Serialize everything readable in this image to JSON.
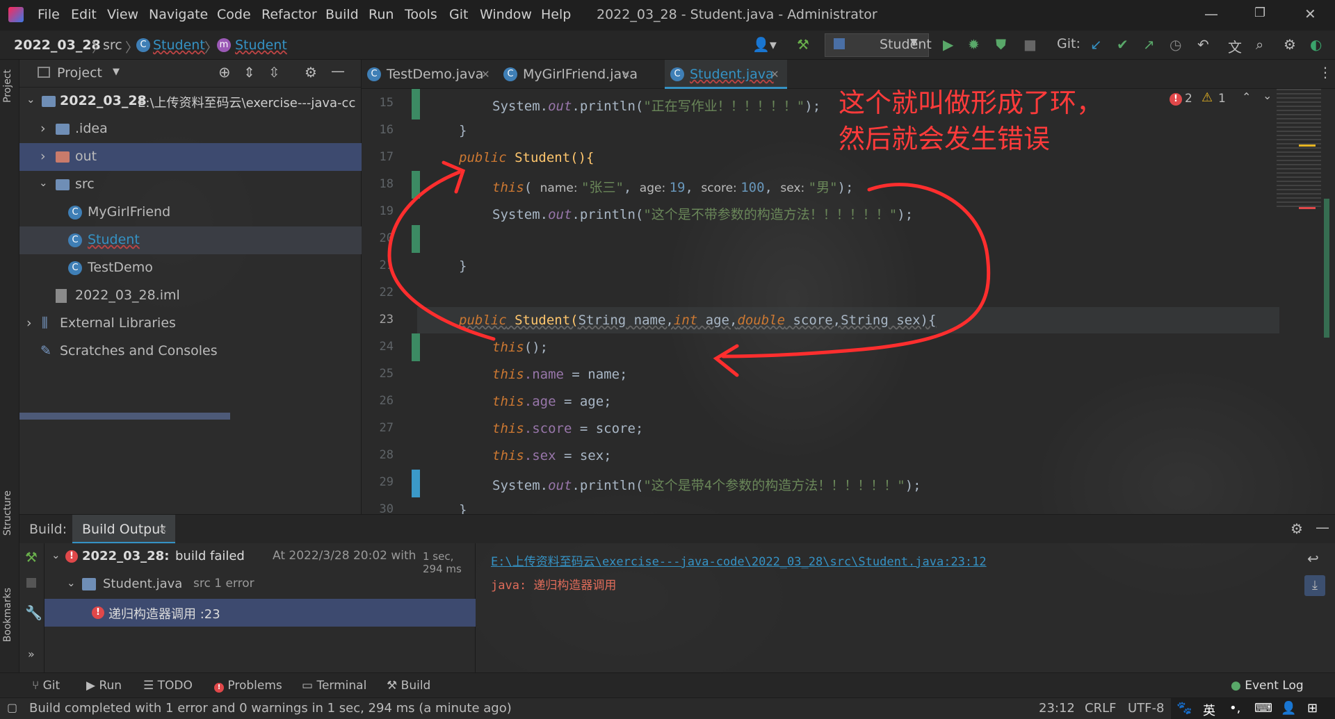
{
  "window": {
    "title": "2022_03_28 - Student.java - Administrator",
    "menu": [
      "File",
      "Edit",
      "View",
      "Navigate",
      "Code",
      "Refactor",
      "Build",
      "Run",
      "Tools",
      "Git",
      "Window",
      "Help"
    ]
  },
  "navbar": {
    "breadcrumbs": [
      "2022_03_28",
      "src",
      "Student",
      "Student"
    ],
    "run_config": "Student",
    "git_label": "Git:"
  },
  "project": {
    "panel_title": "Project",
    "tree": [
      {
        "label": "2022_03_28",
        "detail": "E:\\上传资料至码云\\exercise---java-cc",
        "type": "module"
      },
      {
        "label": ".idea",
        "type": "folder"
      },
      {
        "label": "out",
        "type": "folder-excluded"
      },
      {
        "label": "src",
        "type": "folder"
      },
      {
        "label": "MyGirlFriend",
        "type": "class"
      },
      {
        "label": "Student",
        "type": "class"
      },
      {
        "label": "TestDemo",
        "type": "class"
      },
      {
        "label": "2022_03_28.iml",
        "type": "file"
      },
      {
        "label": "External Libraries",
        "type": "libs"
      },
      {
        "label": "Scratches and Consoles",
        "type": "scratches"
      }
    ]
  },
  "tabs": [
    {
      "label": "TestDemo.java"
    },
    {
      "label": "MyGirlFriend.java"
    },
    {
      "label": "Student.java",
      "active": true
    }
  ],
  "editor": {
    "line_numbers": [
      "15",
      "16",
      "17",
      "18",
      "19",
      "20",
      "21",
      "22",
      "23",
      "24",
      "25",
      "26",
      "27",
      "28",
      "29",
      "30"
    ],
    "inspection": {
      "errors": "2",
      "warnings": "1"
    },
    "annotation_line1": "这个就叫做形成了环，",
    "annotation_line2": "然后就会发生错误",
    "code": {
      "l15_a": "System.",
      "l15_b": "out",
      "l15_c": ".println(",
      "l15_d": "\"正在写作业！！！！！！\"",
      "l15_e": ");",
      "l16": "}",
      "l17_kw": "public",
      "l17_rest": " Student(){",
      "l18_this": "this",
      "l18_open": "( ",
      "l18_h1": "name: ",
      "l18_s1": "\"张三\"",
      "l18_c1": ", ",
      "l18_h2": "age: ",
      "l18_n1": "19",
      "l18_c2": ", ",
      "l18_h3": "score: ",
      "l18_n2": "100",
      "l18_c3": ", ",
      "l18_h4": "sex: ",
      "l18_s2": "\"男\"",
      "l18_end": ");",
      "l19_a": "System.",
      "l19_b": "out",
      "l19_c": ".println(",
      "l19_d": "\"这个是不带参数的构造方法！！！！！！\"",
      "l19_e": ");",
      "l21": "}",
      "l23_kw1": "public",
      "l23_name": " Student(",
      "l23_t1": "String",
      "l23_p1": " name,",
      "l23_t2": "int",
      "l23_p2": " age,",
      "l23_t3": "double",
      "l23_p3": " score,",
      "l23_t4": "String",
      "l23_p4": " sex){",
      "l24_this": "this",
      "l24_rest": "();",
      "l25_this": "this",
      "l25_fld": ".name",
      "l25_rest": " = name;",
      "l26_this": "this",
      "l26_fld": ".age",
      "l26_rest": " = age;",
      "l27_this": "this",
      "l27_fld": ".score",
      "l27_rest": " = score;",
      "l28_this": "this",
      "l28_fld": ".sex",
      "l28_rest": " = sex;",
      "l29_a": "System.",
      "l29_b": "out",
      "l29_c": ".println(",
      "l29_d": "\"这个是带4个参数的构造方法！！！！！！\"",
      "l29_e": ");",
      "l30": "}"
    }
  },
  "build": {
    "label": "Build:",
    "tab": "Build Output",
    "root_project": "2022_03_28:",
    "root_status": "build failed",
    "root_time": "At 2022/3/28 20:02 with",
    "root_duration": "1 sec, 294 ms",
    "file_label": "Student.java",
    "file_detail": "src 1 error",
    "error_item": "递归构造器调用 :23",
    "output_path": "E:\\上传资料至码云\\exercise---java-code\\2022_03_28\\src\\Student.java:23:12",
    "output_error": "java: 递归构造器调用"
  },
  "toolwindows": [
    "Git",
    "Run",
    "TODO",
    "Problems",
    "Terminal",
    "Build"
  ],
  "event_log": "Event Log",
  "status": {
    "message": "Build completed with 1 error and 0 warnings in 1 sec, 294 ms (a minute ago)",
    "position": "23:12",
    "line_sep": "CRLF",
    "encoding": "UTF-8",
    "ime": "英"
  },
  "side_labels": {
    "project": "Project",
    "structure": "Structure",
    "bookmarks": "Bookmarks"
  },
  "colors": {
    "accent": "#3592c4",
    "error": "#e0484a",
    "annotation": "#ff3b3b"
  }
}
